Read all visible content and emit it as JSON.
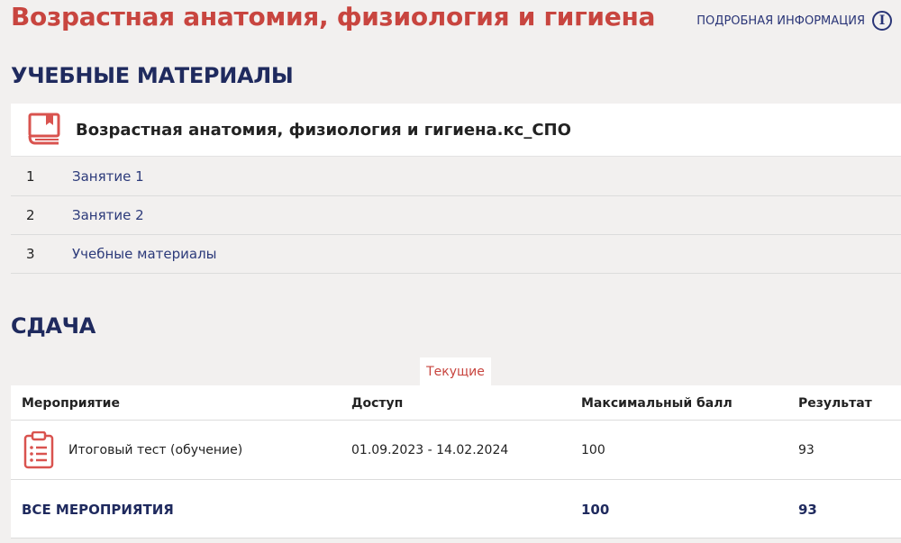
{
  "header": {
    "course_title": "Возрастная анатомия, физиология и гигиена",
    "info_link_label": "ПОДРОБНАЯ ИНФОРМАЦИЯ"
  },
  "materials": {
    "heading": "УЧЕБНЫЕ МАТЕРИАЛЫ",
    "card_title": "Возрастная анатомия, физиология и гигиена.кс_СПО",
    "lessons": [
      {
        "num": "1",
        "label": "Занятие 1"
      },
      {
        "num": "2",
        "label": "Занятие 2"
      },
      {
        "num": "3",
        "label": "Учебные материалы"
      }
    ]
  },
  "submission": {
    "heading": "СДАЧА",
    "tab_label": "Текущие",
    "columns": [
      "Мероприятие",
      "Доступ",
      "Максимальный балл",
      "Результат"
    ],
    "rows": [
      {
        "event": "Итоговый тест (обучение)",
        "access": "01.09.2023 - 14.02.2024",
        "max_score": "100",
        "result": "93"
      }
    ],
    "total": {
      "label": "ВСЕ МЕРОПРИЯТИЯ",
      "max_score": "100",
      "result": "93"
    }
  },
  "colors": {
    "accent_red": "#c8453f",
    "navy": "#1f2a5e",
    "link_blue": "#2c3a7a",
    "background": "#f2f0ef"
  },
  "icons": [
    "info-icon",
    "book-icon",
    "clipboard-list-icon"
  ]
}
